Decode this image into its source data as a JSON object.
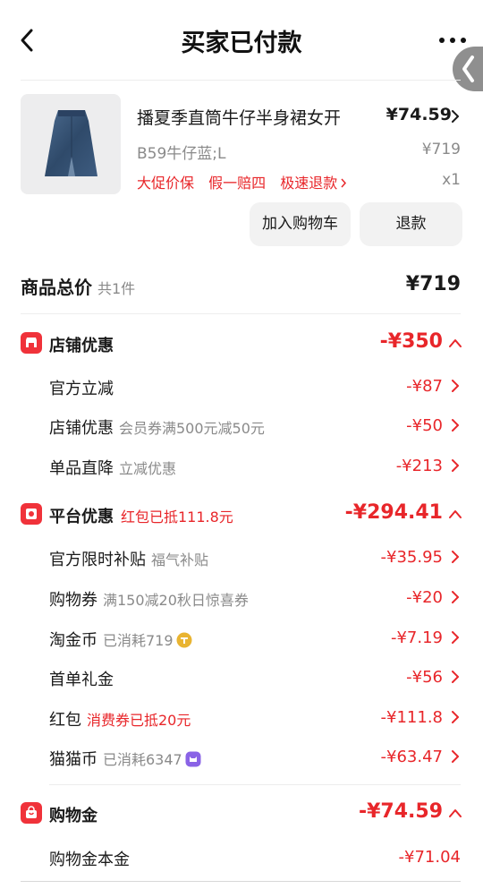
{
  "header": {
    "title": "买家已付款"
  },
  "product": {
    "image_icon": "denim-skirt-thumbnail",
    "title": "播夏季直筒牛仔半身裙女开",
    "price": "¥74.59",
    "sku": "B59牛仔蓝;L",
    "original_price": "¥719",
    "tags": [
      "大促价保",
      "假一赔四",
      "极速退款"
    ],
    "quantity": "x1",
    "add_to_cart_label": "加入购物车",
    "refund_label": "退款"
  },
  "total": {
    "label": "商品总价",
    "count": "共1件",
    "value": "¥719"
  },
  "shop_discount": {
    "icon": "shop-icon",
    "title": "店铺优惠",
    "value": "-¥350",
    "rows": [
      {
        "label": "官方立减",
        "sub": "",
        "value": "-¥87"
      },
      {
        "label": "店铺优惠",
        "sub": "会员券满500元减50元",
        "value": "-¥50"
      },
      {
        "label": "单品直降",
        "sub": "立减优惠",
        "value": "-¥213"
      }
    ]
  },
  "platform_discount": {
    "icon": "red-packet-icon",
    "title": "平台优惠",
    "note": "红包已抵111.8元",
    "value": "-¥294.41",
    "rows": [
      {
        "label": "官方限时补贴",
        "sub": "福气补贴",
        "value": "-¥35.95"
      },
      {
        "label": "购物券",
        "sub": "满150减20秋日惊喜券",
        "value": "-¥20"
      },
      {
        "label": "淘金币",
        "sub": "已消耗719",
        "value": "-¥7.19"
      },
      {
        "label": "首单礼金",
        "sub": "",
        "value": "-¥56"
      },
      {
        "label": "红包",
        "sub": "消费券已抵20元",
        "value": "-¥111.8"
      },
      {
        "label": "猫猫币",
        "sub": "已消耗6347",
        "value": "-¥63.47"
      }
    ]
  },
  "shopping_gold": {
    "icon": "shopping-bag-icon",
    "title": "购物金",
    "value": "-¥74.59",
    "rows": [
      {
        "label": "购物金本金",
        "value": "-¥71.04"
      }
    ]
  },
  "colors": {
    "accent_red": "#e8262a",
    "icon_red": "#f0323a",
    "gold_coin": "#e9b431",
    "cat_coin": "#8a63e6"
  }
}
